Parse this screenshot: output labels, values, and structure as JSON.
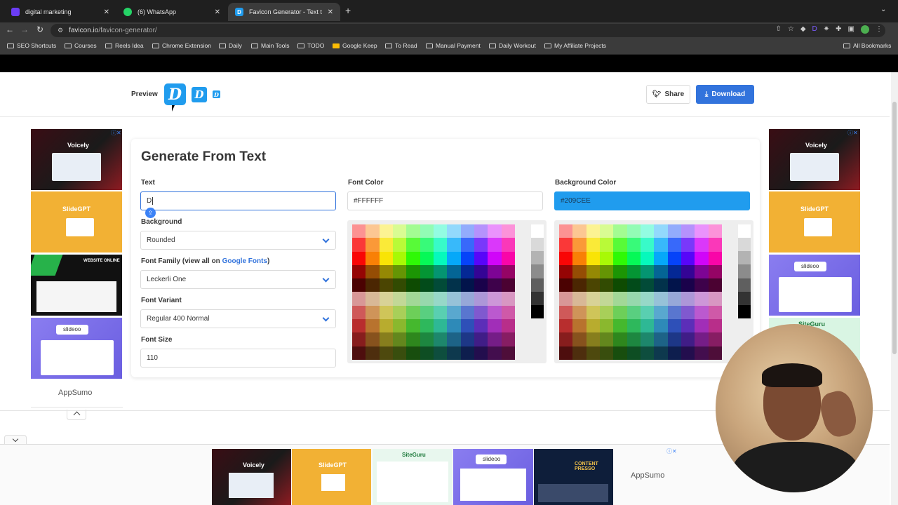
{
  "browser": {
    "tabs": [
      {
        "title": "digital marketing",
        "favicon_color": "#6b3df5"
      },
      {
        "title": "(6) WhatsApp",
        "favicon_color": "#25D366"
      },
      {
        "title": "Favicon Generator - Text to Fa",
        "favicon_color": "#209CEE"
      }
    ],
    "url_domain": "favicon.io",
    "url_path": "/favicon-generator/",
    "bookmarks": [
      "SEO Shortcuts",
      "Courses",
      "Reels Idea",
      "Chrome Extension",
      "Daily",
      "Main Tools",
      "TODO",
      "Google Keep",
      "To Read",
      "Manual Payment",
      "Daily Workout",
      "My Affiliate Projects"
    ],
    "all_bookmarks": "All Bookmarks"
  },
  "preview": {
    "label": "Preview",
    "icon_letter": "D",
    "share_label": "Share",
    "download_label": "Download"
  },
  "generator": {
    "title": "Generate From Text",
    "text_label": "Text",
    "text_value": "D",
    "background_label": "Background",
    "background_value": "Rounded",
    "font_family_label": "Font Family (view all on ",
    "font_family_link": "Google Fonts",
    "font_family_label_end": ")",
    "font_family_value": "Leckerli One",
    "font_variant_label": "Font Variant",
    "font_variant_value": "Regular 400 Normal",
    "font_size_label": "Font Size",
    "font_size_value": "110",
    "font_color_label": "Font Color",
    "font_color_value": "#FFFFFF",
    "bg_color_label": "Background Color",
    "bg_color_value": "#209CEE"
  },
  "ads": {
    "left": [
      "Voicely",
      "SlideGPT",
      "WEBSITE ONLINE",
      "slideoo"
    ],
    "right": [
      "Voicely",
      "SlideGPT",
      "slideoo",
      "SiteGuru"
    ],
    "bottom": [
      "Voicely",
      "SlideGPT",
      "SiteGuru",
      "slideoo",
      "CONTENT PRESSO"
    ],
    "appsumo": "AppSumo"
  },
  "colors": {
    "accent": "#209CEE",
    "link": "#3273dc"
  }
}
